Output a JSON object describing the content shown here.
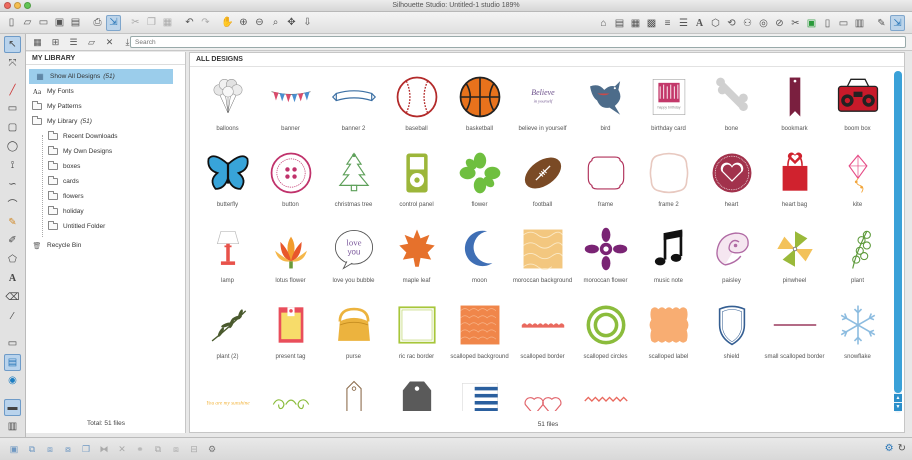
{
  "window": {
    "title": "Silhouette Studio: Untitled-1 studio 189%"
  },
  "search": {
    "placeholder": "Search"
  },
  "library": {
    "title": "MY LIBRARY",
    "items": [
      {
        "label": "Show All Designs",
        "count": "(51)",
        "icon": "all-designs-icon",
        "depth": 0
      },
      {
        "label": "My Fonts",
        "icon": "fonts-icon",
        "depth": 0
      },
      {
        "label": "My Patterns",
        "icon": "folder-icon",
        "depth": 0
      },
      {
        "label": "My Library",
        "count": "(51)",
        "icon": "folder-icon",
        "depth": 0
      },
      {
        "label": "Recent Downloads",
        "icon": "folder-icon",
        "depth": 1
      },
      {
        "label": "My Own Designs",
        "icon": "folder-icon",
        "depth": 1
      },
      {
        "label": "boxes",
        "icon": "folder-icon",
        "depth": 1
      },
      {
        "label": "cards",
        "icon": "folder-icon",
        "depth": 1
      },
      {
        "label": "flowers",
        "icon": "folder-icon",
        "depth": 1
      },
      {
        "label": "holiday",
        "icon": "folder-icon",
        "depth": 1
      },
      {
        "label": "Untitled Folder",
        "icon": "folder-icon",
        "depth": 1
      },
      {
        "label": "Recycle Bin",
        "icon": "trash-icon",
        "depth": 0
      }
    ],
    "total": "Total: 51 files"
  },
  "designs": {
    "title": "ALL DESIGNS",
    "files": "51 files",
    "items": [
      {
        "label": "balloons",
        "icon": "balloons"
      },
      {
        "label": "banner",
        "icon": "banner"
      },
      {
        "label": "banner 2",
        "icon": "banner2"
      },
      {
        "label": "baseball",
        "icon": "baseball"
      },
      {
        "label": "basketball",
        "icon": "basketball"
      },
      {
        "label": "believe in yourself",
        "icon": "believe"
      },
      {
        "label": "bird",
        "icon": "bird"
      },
      {
        "label": "birthday card",
        "icon": "birthday-card"
      },
      {
        "label": "bone",
        "icon": "bone"
      },
      {
        "label": "bookmark",
        "icon": "bookmark"
      },
      {
        "label": "boom box",
        "icon": "boombox"
      },
      {
        "label": "butterfly",
        "icon": "butterfly"
      },
      {
        "label": "button",
        "icon": "button"
      },
      {
        "label": "christmas tree",
        "icon": "tree"
      },
      {
        "label": "control panel",
        "icon": "control-panel"
      },
      {
        "label": "flower",
        "icon": "flower"
      },
      {
        "label": "football",
        "icon": "football"
      },
      {
        "label": "frame",
        "icon": "frame"
      },
      {
        "label": "frame 2",
        "icon": "frame2"
      },
      {
        "label": "heart",
        "icon": "heart"
      },
      {
        "label": "heart bag",
        "icon": "heart-bag"
      },
      {
        "label": "kite",
        "icon": "kite"
      },
      {
        "label": "lamp",
        "icon": "lamp"
      },
      {
        "label": "lotus flower",
        "icon": "lotus"
      },
      {
        "label": "love you bubble",
        "icon": "love-bubble"
      },
      {
        "label": "maple leaf",
        "icon": "maple"
      },
      {
        "label": "moon",
        "icon": "moon"
      },
      {
        "label": "moroccan background",
        "icon": "moroccan-bg"
      },
      {
        "label": "moroccan flower",
        "icon": "moroccan-flower"
      },
      {
        "label": "music note",
        "icon": "music-note"
      },
      {
        "label": "paisley",
        "icon": "paisley"
      },
      {
        "label": "pinwheel",
        "icon": "pinwheel"
      },
      {
        "label": "plant",
        "icon": "plant"
      },
      {
        "label": "plant (2)",
        "icon": "plant2"
      },
      {
        "label": "present tag",
        "icon": "present-tag"
      },
      {
        "label": "purse",
        "icon": "purse"
      },
      {
        "label": "ric rac border",
        "icon": "ricrac-border"
      },
      {
        "label": "scalloped background",
        "icon": "scallop-bg"
      },
      {
        "label": "scalloped border",
        "icon": "scallop-border"
      },
      {
        "label": "scalloped circles",
        "icon": "scallop-circles"
      },
      {
        "label": "scalloped label",
        "icon": "scallop-label"
      },
      {
        "label": "shield",
        "icon": "shield"
      },
      {
        "label": "small scalloped border",
        "icon": "small-scallop"
      },
      {
        "label": "snowflake",
        "icon": "snowflake"
      },
      {
        "label": "",
        "icon": "sunshine",
        "thumb_text": "You are my sunshine"
      },
      {
        "label": "",
        "icon": "swirls"
      },
      {
        "label": "",
        "icon": "tag"
      },
      {
        "label": "",
        "icon": "dark-tag"
      },
      {
        "label": "",
        "icon": "stripes"
      },
      {
        "label": "",
        "icon": "hearts"
      },
      {
        "label": "",
        "icon": "zigzag"
      }
    ]
  },
  "colors": {
    "selection": "#9bcdeb",
    "scrollbar": "#3aa1d8",
    "accent": "#1d7ec2"
  }
}
